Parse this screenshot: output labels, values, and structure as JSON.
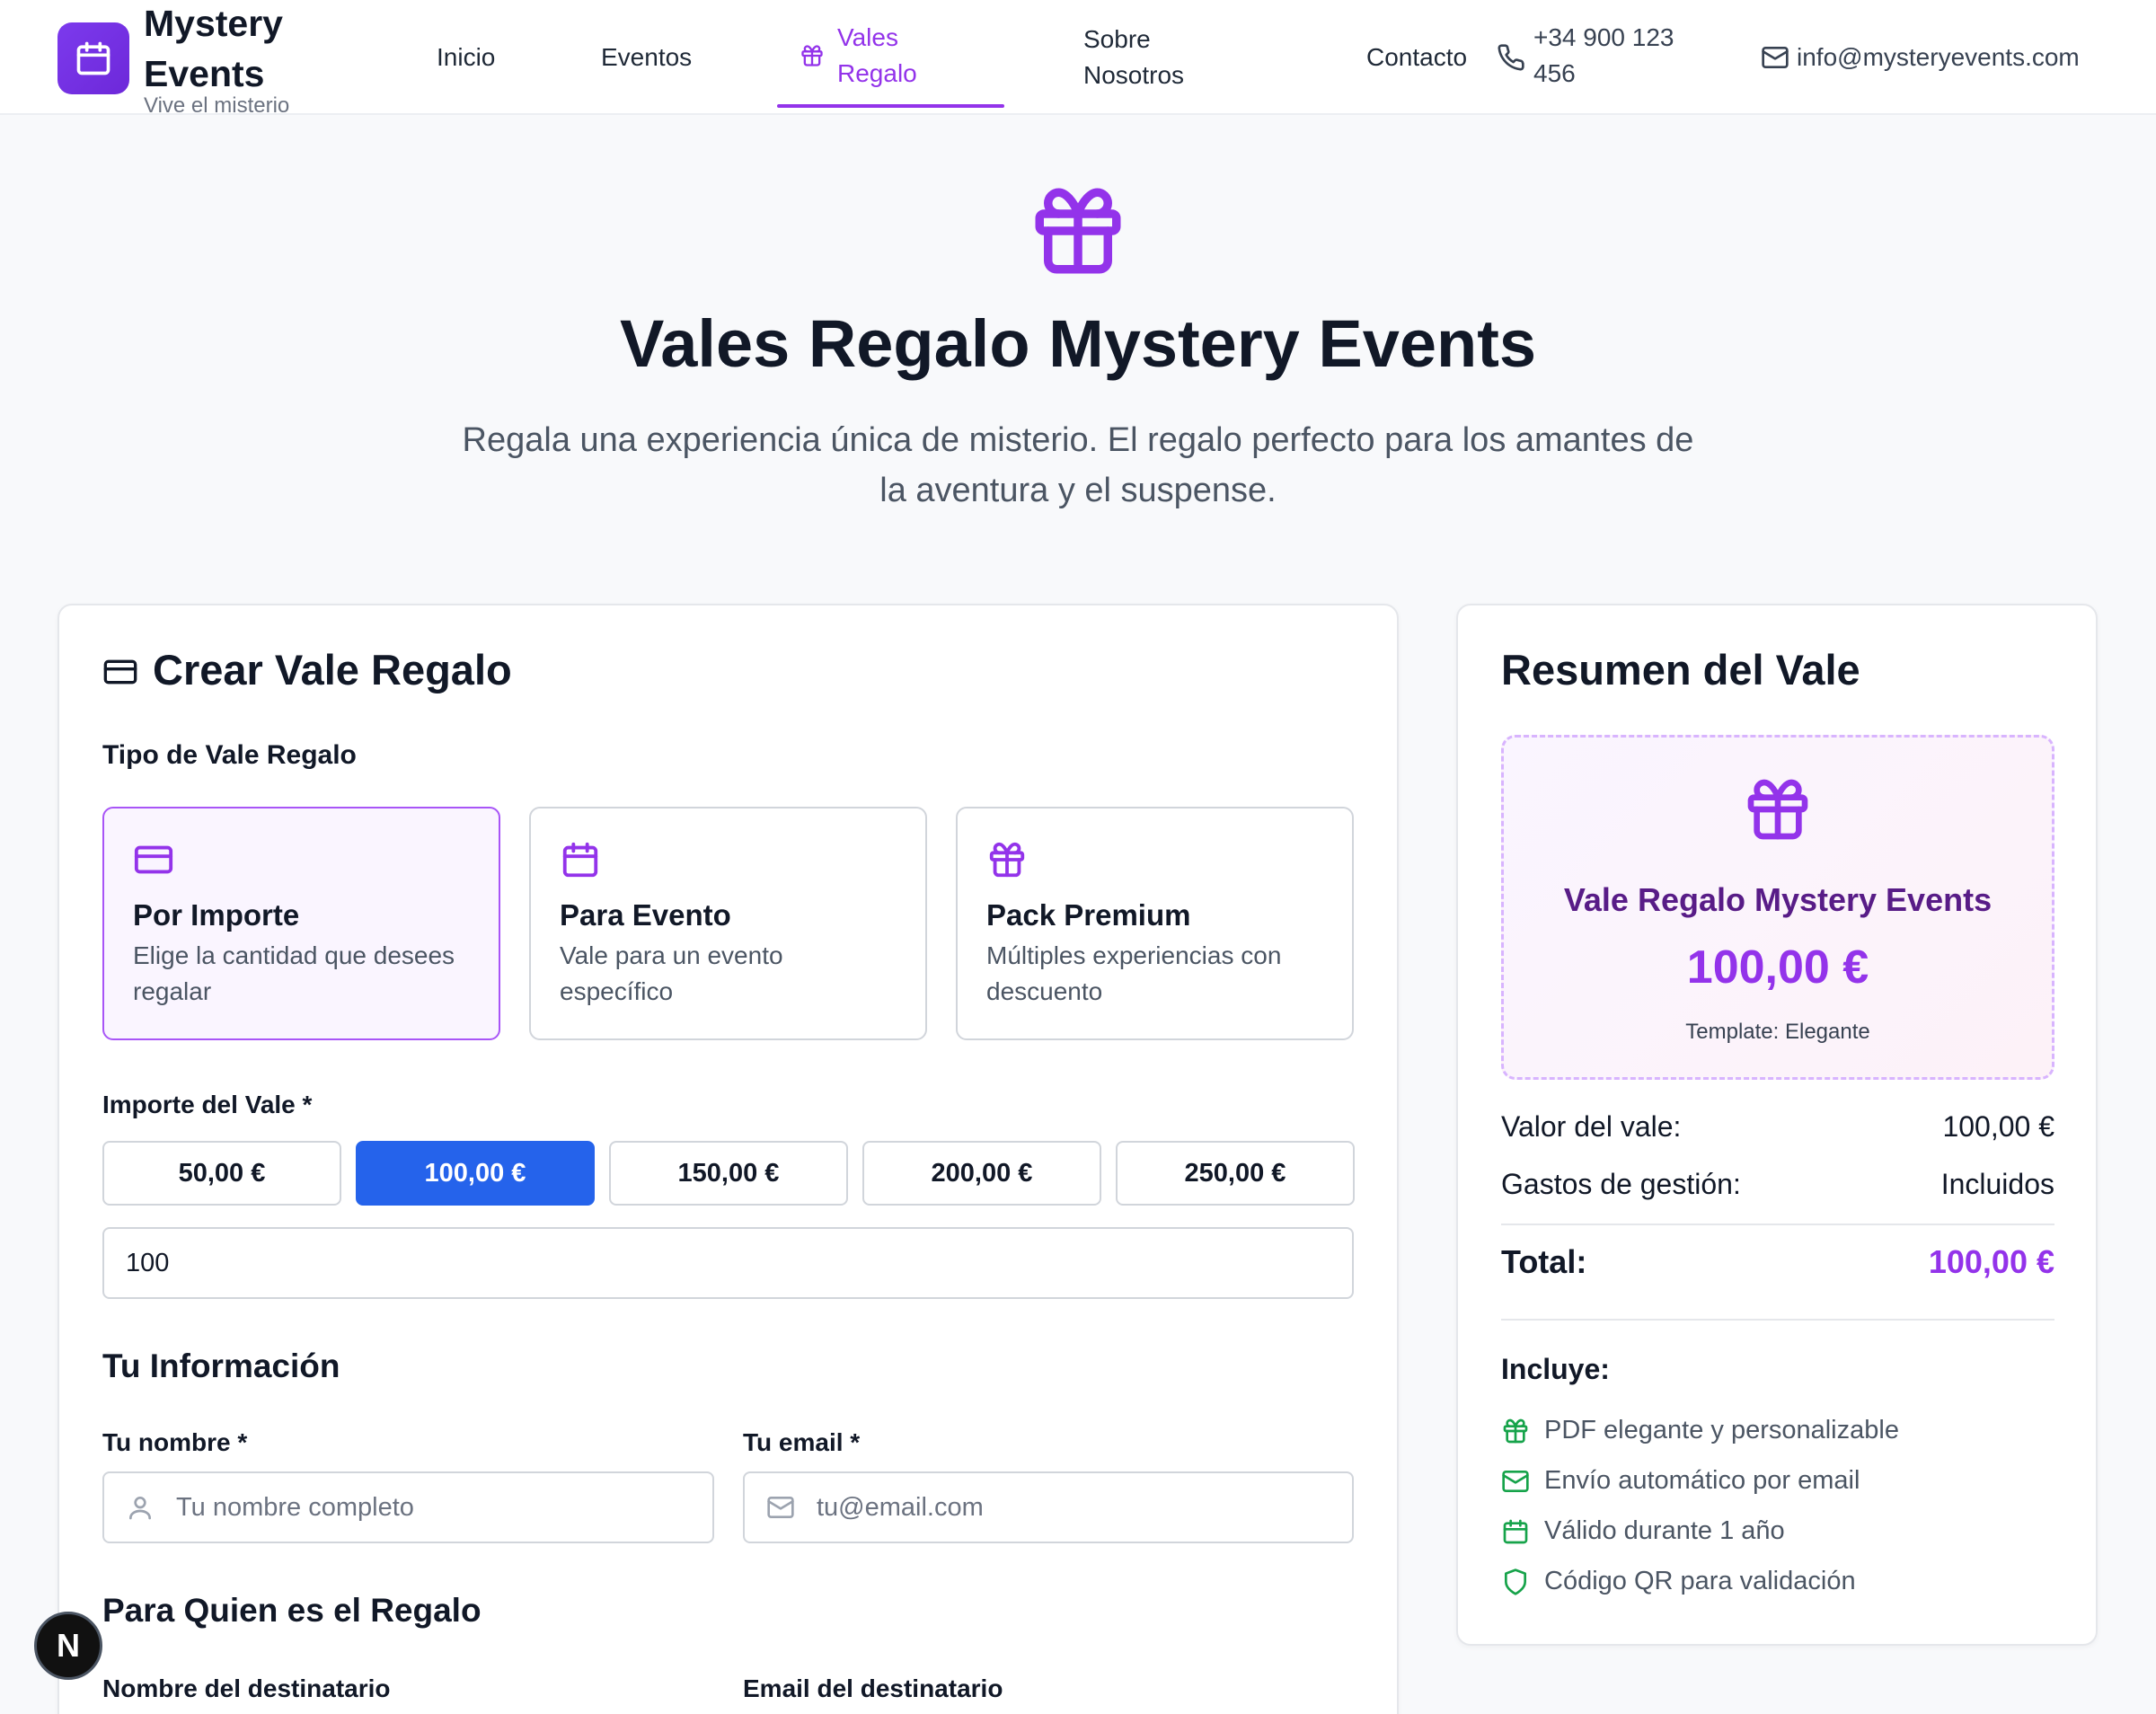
{
  "brand": {
    "name": "Mystery Events",
    "tagline": "Vive el misterio"
  },
  "nav": {
    "inicio": "Inicio",
    "eventos": "Eventos",
    "vales_regalo": "Vales Regalo",
    "sobre_nosotros": "Sobre Nosotros",
    "contacto": "Contacto"
  },
  "contact": {
    "phone": "+34 900 123 456",
    "email": "info@mysteryevents.com"
  },
  "hero": {
    "title": "Vales Regalo Mystery Events",
    "subtitle": "Regala una experiencia única de misterio. El regalo perfecto para los amantes de la aventura y el suspense."
  },
  "form": {
    "title": "Crear Vale Regalo",
    "type_label": "Tipo de Vale Regalo",
    "types": [
      {
        "title": "Por Importe",
        "desc": "Elige la cantidad que desees regalar",
        "icon": "credit-card-icon",
        "selected": true
      },
      {
        "title": "Para Evento",
        "desc": "Vale para un evento específico",
        "icon": "calendar-icon",
        "selected": false
      },
      {
        "title": "Pack Premium",
        "desc": "Múltiples experiencias con descuento",
        "icon": "gift-icon",
        "selected": false
      }
    ],
    "amount_label": "Importe del Vale *",
    "amounts": [
      "50,00 €",
      "100,00 €",
      "150,00 €",
      "200,00 €",
      "250,00 €"
    ],
    "selected_amount_index": 1,
    "custom_amount_value": "100",
    "your_info_title": "Tu Información",
    "name_label": "Tu nombre *",
    "name_placeholder": "Tu nombre completo",
    "email_label": "Tu email *",
    "email_placeholder": "tu@email.com",
    "recipient_title": "Para Quien es el Regalo",
    "recipient_name_label": "Nombre del destinatario",
    "recipient_email_label": "Email del destinatario"
  },
  "summary": {
    "title": "Resumen del Vale",
    "voucher_title": "Vale Regalo Mystery Events",
    "voucher_amount": "100,00 €",
    "template_text": "Template: Elegante",
    "value_label": "Valor del vale:",
    "value": "100,00 €",
    "fees_label": "Gastos de gestión:",
    "fees": "Incluidos",
    "total_label": "Total:",
    "total": "100,00 €",
    "includes_title": "Incluye:",
    "includes": [
      {
        "text": "PDF elegante y personalizable",
        "icon": "gift-icon"
      },
      {
        "text": "Envío automático por email",
        "icon": "mail-icon"
      },
      {
        "text": "Válido durante 1 año",
        "icon": "calendar-icon"
      },
      {
        "text": "Código QR para validación",
        "icon": "shield-icon"
      }
    ]
  },
  "floating_button": "N",
  "colors": {
    "accent": "#9333ea",
    "primary_blue": "#2563eb",
    "success": "#16a34a"
  }
}
